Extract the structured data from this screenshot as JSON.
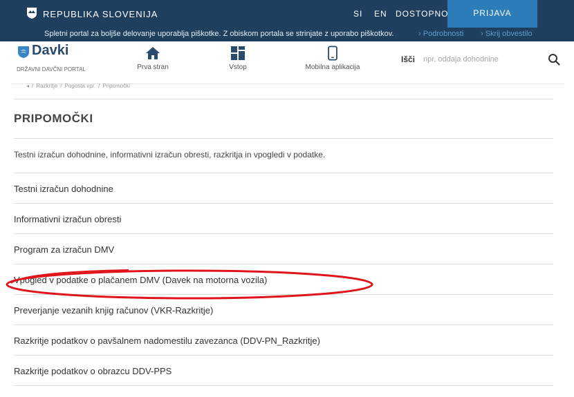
{
  "topbar": {
    "gov_name": "REPUBLIKA SLOVENIJA",
    "lang_si": "SI",
    "lang_en": "EN",
    "accessibility": "DOSTOPNOST ⌄",
    "login": "PRIJAVA"
  },
  "cookie": {
    "text": "Spletni portal za boljše delovanje uporablja piškotke. Z obiskom portala se strinjate z uporabo piškotkov.",
    "details": "› Podrobnosti",
    "hide": "› Skrij obvestilo"
  },
  "header": {
    "brand_title": "Davki",
    "brand_sub": "DRŽAVNI DAVČNI PORTAL",
    "nav": [
      {
        "label": "Prva stran",
        "icon": "home-icon"
      },
      {
        "label": "Vstop",
        "icon": "grid-icon"
      },
      {
        "label": "Mobilna aplikacija",
        "icon": "mobile-icon"
      }
    ],
    "search_label": "Išči",
    "search_placeholder": "npr. oddaja dohodnine"
  },
  "breadcrumb": [
    "◂",
    "Razkritje",
    "Pogosta vpr.",
    "Pripomočki"
  ],
  "page": {
    "title": "PRIPOMOČKI",
    "intro": "Testni izračun dohodnine, informativni izračun obresti, razkritja in vpogledi v podatke."
  },
  "items": [
    "Testni izračun dohodnine",
    "Informativni izračun obresti",
    "Program za izračun DMV",
    "Vpogled v podatke o plačanem DMV (Davek na motorna vozila)",
    "Preverjanje vezanih knjig računov (VKR-Razkritje)",
    "Razkritje podatkov o pavšalnem nadomestilu zavezanca (DDV-PN_Razkritje)",
    "Razkritje podatkov o obrazcu DDV-PPS"
  ],
  "colors": {
    "topbar": "#1f3f5f",
    "login": "#2d7db8",
    "highlight": "#e0141b"
  }
}
